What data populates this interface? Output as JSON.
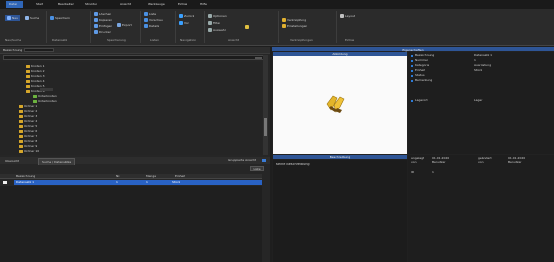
{
  "menubar": {
    "items": [
      "Datei",
      "Start",
      "Bearbeiten",
      "Struktur",
      "Ansicht",
      "Werkzeuge",
      "Extras",
      "Hilfe"
    ]
  },
  "ribbon": {
    "groups": [
      {
        "label": "Neu/Suche"
      },
      {
        "label": "Datensatz"
      },
      {
        "label": "Speicherung"
      },
      {
        "label": "Listen"
      },
      {
        "label": "Navigation"
      },
      {
        "label": "Ansicht"
      },
      {
        "label": "Verknüpfungen"
      },
      {
        "label": "Extras"
      }
    ],
    "buttons": [
      "Neu",
      "Suche",
      "Speichern",
      "Löschen",
      "Kopieren",
      "Einfügen",
      "Drucken",
      "Export",
      "Liste",
      "Vorschau",
      "Details",
      "Zurück",
      "Vor",
      "Optionen",
      "Filter",
      "Auswahl",
      "Verknüpfung",
      "Einstellungen",
      "Layout"
    ]
  },
  "left": {
    "filter_label": "Bezeichnung",
    "filter_value": "",
    "search_value": "",
    "tree": [
      {
        "label": "Knoten 1",
        "color": "#d6a72b",
        "depth": 2
      },
      {
        "label": "Knoten 2",
        "color": "#d6a72b",
        "depth": 2
      },
      {
        "label": "Knoten 3",
        "color": "#d6a72b",
        "depth": 2
      },
      {
        "label": "Knoten 4",
        "color": "#d6a72b",
        "depth": 2
      },
      {
        "label": "Knoten 5",
        "color": "#d6a72b",
        "depth": 2
      },
      {
        "label": "Knoten 6",
        "color": "#d6a72b",
        "depth": 2
      },
      {
        "label": "Unterknoten",
        "color": "#6cb33f",
        "depth": 3
      },
      {
        "label": "Unterknoten",
        "color": "#6cb33f",
        "depth": 3
      },
      {
        "label": "Ordner 1",
        "color": "#d6a72b",
        "depth": 1
      },
      {
        "label": "Ordner 2",
        "color": "#d6a72b",
        "depth": 1
      },
      {
        "label": "Ordner 3",
        "color": "#d6a72b",
        "depth": 1
      },
      {
        "label": "Ordner 4",
        "color": "#d6a72b",
        "depth": 1
      },
      {
        "label": "Ordner 5",
        "color": "#d6a72b",
        "depth": 1
      },
      {
        "label": "Ordner 6",
        "color": "#d6a72b",
        "depth": 1
      },
      {
        "label": "Ordner 7",
        "color": "#d6a72b",
        "depth": 1
      },
      {
        "label": "Ordner 8",
        "color": "#d6a72b",
        "depth": 1
      },
      {
        "label": "Ordner 9",
        "color": "#d6a72b",
        "depth": 1
      },
      {
        "label": "Ordner 10",
        "color": "#d6a72b",
        "depth": 1
      }
    ],
    "tabs": [
      "Übersicht",
      "Suche / Datensätze"
    ],
    "filter_hint": "Gruppierte Ansicht",
    "grid_button": "Liste",
    "grid_columns": [
      "Bezeichnung",
      "Nr.",
      "Menge",
      "Einheit"
    ],
    "grid_row": [
      "Datensatz 1",
      "1",
      "1",
      "Stück"
    ]
  },
  "right": {
    "panel_title": "Eigenschaften",
    "image_title": "Abbildung",
    "props": [
      {
        "key": "Bezeichnung",
        "value": "Datensatz 1"
      },
      {
        "key": "Nummer",
        "value": "1"
      },
      {
        "key": "Kategorie",
        "value": "Ausrüstung"
      },
      {
        "key": "Einheit",
        "value": "Stück"
      },
      {
        "key": "Status",
        "value": ""
      },
      {
        "key": "Bemerkung",
        "value": ""
      },
      {
        "key": "Lagerort",
        "value": "Lager"
      }
    ],
    "desc_title": "Beschreibung",
    "desc_text": "Keine Beschreibung",
    "info": [
      {
        "key": "angelegt",
        "value": "01.01.2020",
        "k2": "geändert",
        "v2": "01.01.2020"
      },
      {
        "key": "von",
        "value": "Benutzer",
        "k2": "von",
        "v2": "Benutzer"
      },
      {
        "key": "ID",
        "value": "1",
        "k2": "",
        "v2": ""
      }
    ]
  },
  "colors": {
    "accent": "#2e5596",
    "selection": "#2962c4",
    "folder": "#d6a72b"
  }
}
